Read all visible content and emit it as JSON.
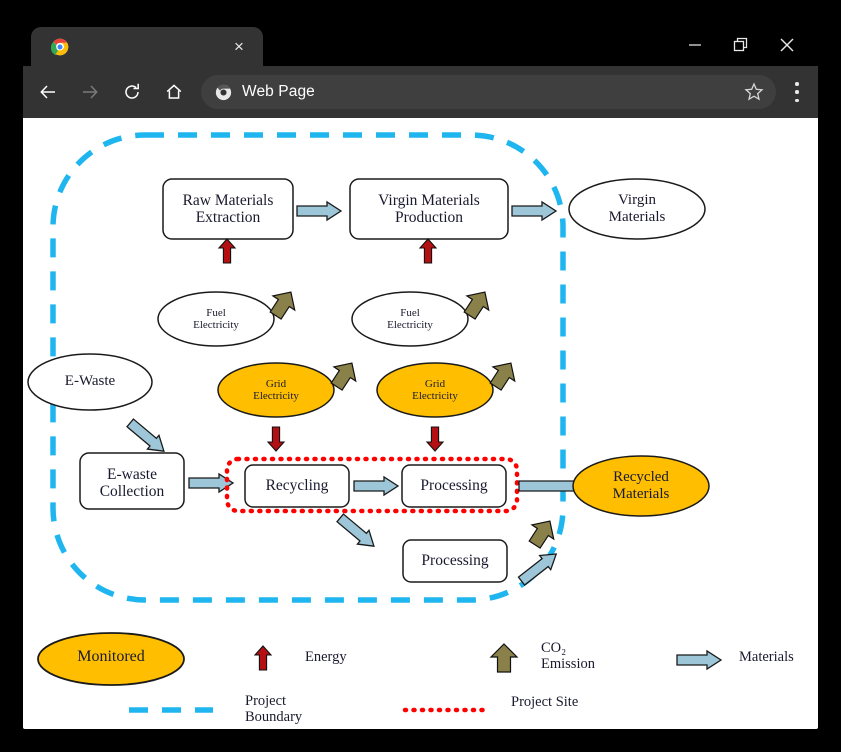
{
  "window": {
    "tab_title": "",
    "tab_close_label": "×",
    "controls": {
      "minimize": "minimize-icon",
      "maximize": "maximize-icon",
      "close": "close-icon"
    }
  },
  "toolbar": {
    "back": "back-arrow-icon",
    "forward": "forward-arrow-icon",
    "reload": "reload-icon",
    "home": "home-icon",
    "address_text": "Web Page",
    "bookmark": "star-icon",
    "menu": "three-dot-menu-icon"
  },
  "diagram": {
    "nodes": {
      "raw_materials_extraction": "Raw Materials\nExtraction",
      "virgin_materials_production": "Virgin Materials\nProduction",
      "virgin_materials": "Virgin\nMaterials",
      "fuel_electricity_1": "Fuel\nElectricity",
      "fuel_electricity_2": "Fuel\nElectricity",
      "grid_electricity_1": "Grid\nElectricity",
      "grid_electricity_2": "Grid\nElectricity",
      "e_waste": "E-Waste",
      "e_waste_collection": "E-waste\nCollection",
      "recycling": "Recycling",
      "processing_1": "Processing",
      "processing_2": "Processing",
      "recycled_materials": "Recycled\nMaterials"
    },
    "legend": {
      "monitored": "Monitored",
      "energy": "Energy",
      "co2_emission": "CO₂\nEmission",
      "materials": "Materials",
      "project_boundary": "Project\nBoundary",
      "project_site": "Project Site"
    },
    "colors": {
      "monitored_fill": "#FFBF00",
      "energy_arrow": "#B40F12",
      "co2_arrow": "#8A8049",
      "materials_arrow": "#9DC7D8",
      "project_boundary": "#1FB6EF",
      "project_site": "#FF0000",
      "node_stroke": "#1a1a1a",
      "page_background": "#FFFFFF"
    }
  }
}
